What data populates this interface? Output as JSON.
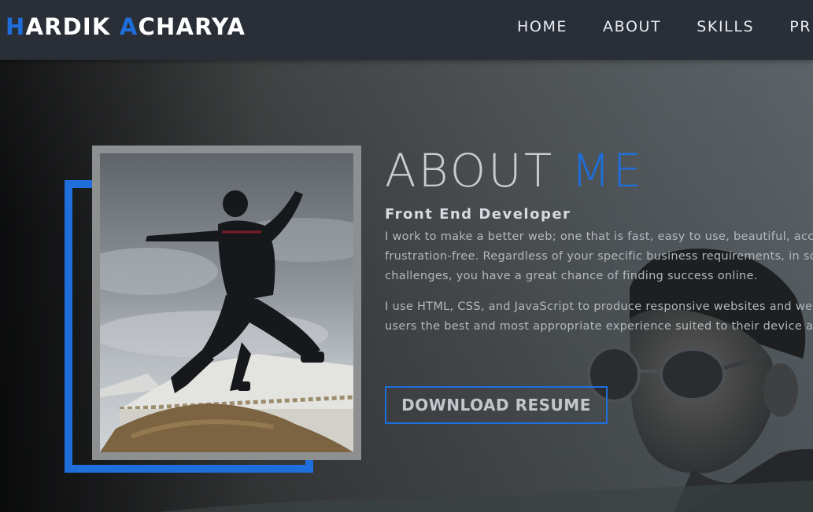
{
  "brand": {
    "first_initial": "H",
    "first_rest": "ARDIK ",
    "last_initial": "A",
    "last_rest": "CHARYA"
  },
  "nav": {
    "items": [
      {
        "label": "HOME"
      },
      {
        "label": "ABOUT"
      },
      {
        "label": "SKILLS"
      },
      {
        "label": "PR"
      }
    ]
  },
  "about": {
    "title_main": "ABOUT ",
    "title_accent": "ME",
    "subtitle": "Front End Developer",
    "paragraph_1_lines": [
      "I work to make a better web; one that is fast, easy to use, beautiful, access",
      "frustration-free. Regardless of your specific business requirements, in solv",
      "challenges, you have a great chance of finding success online."
    ],
    "paragraph_2_lines": [
      "I use HTML, CSS, and JavaScript to produce responsive websites and web a",
      "users the best and most appropriate experience suited to their device and"
    ],
    "download_label": "DOWNLOAD RESUME"
  },
  "colors": {
    "accent": "#1e6fdb",
    "navbar_bg": "#292e37",
    "frame_grey": "#8e8f91"
  },
  "icons": {
    "photo": "profile-photo"
  }
}
